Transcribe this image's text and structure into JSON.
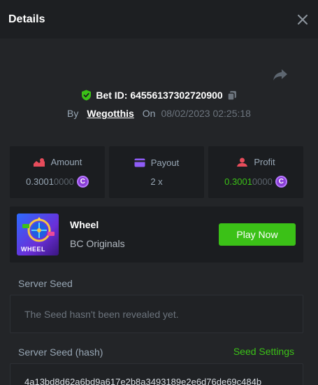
{
  "header": {
    "title": "Details"
  },
  "bet": {
    "id_label": "Bet ID: 64556137302720900",
    "by_label": "By",
    "username": "Wegotthis",
    "on_label": "On",
    "datetime": "08/02/2023 02:25:18"
  },
  "stats": {
    "amount": {
      "label": "Amount",
      "value_main": "0.3001",
      "value_tail": "0000",
      "currency_glyph": "C"
    },
    "payout": {
      "label": "Payout",
      "value": "2 x"
    },
    "profit": {
      "label": "Profit",
      "value_main": "0.3001",
      "value_tail": "0000",
      "currency_glyph": "C"
    }
  },
  "game": {
    "name": "Wheel",
    "provider": "BC Originals",
    "thumbnail_text": "WHEEL",
    "play_label": "Play Now"
  },
  "server_seed": {
    "label": "Server Seed",
    "message": "The Seed hasn't been revealed yet."
  },
  "server_seed_hash": {
    "label": "Server Seed (hash)",
    "settings_label": "Seed Settings",
    "value": "4a13bd8d62a6bd9a617e2b8a3493189e2e6d76de69c484b"
  },
  "colors": {
    "accent_green": "#3bc117",
    "currency_purple": "#8a3fd6",
    "amount_icon": "#e74c5b",
    "payout_icon": "#8f5cf7",
    "profit_icon": "#e74c5b",
    "verified_shield": "#3bc117"
  }
}
